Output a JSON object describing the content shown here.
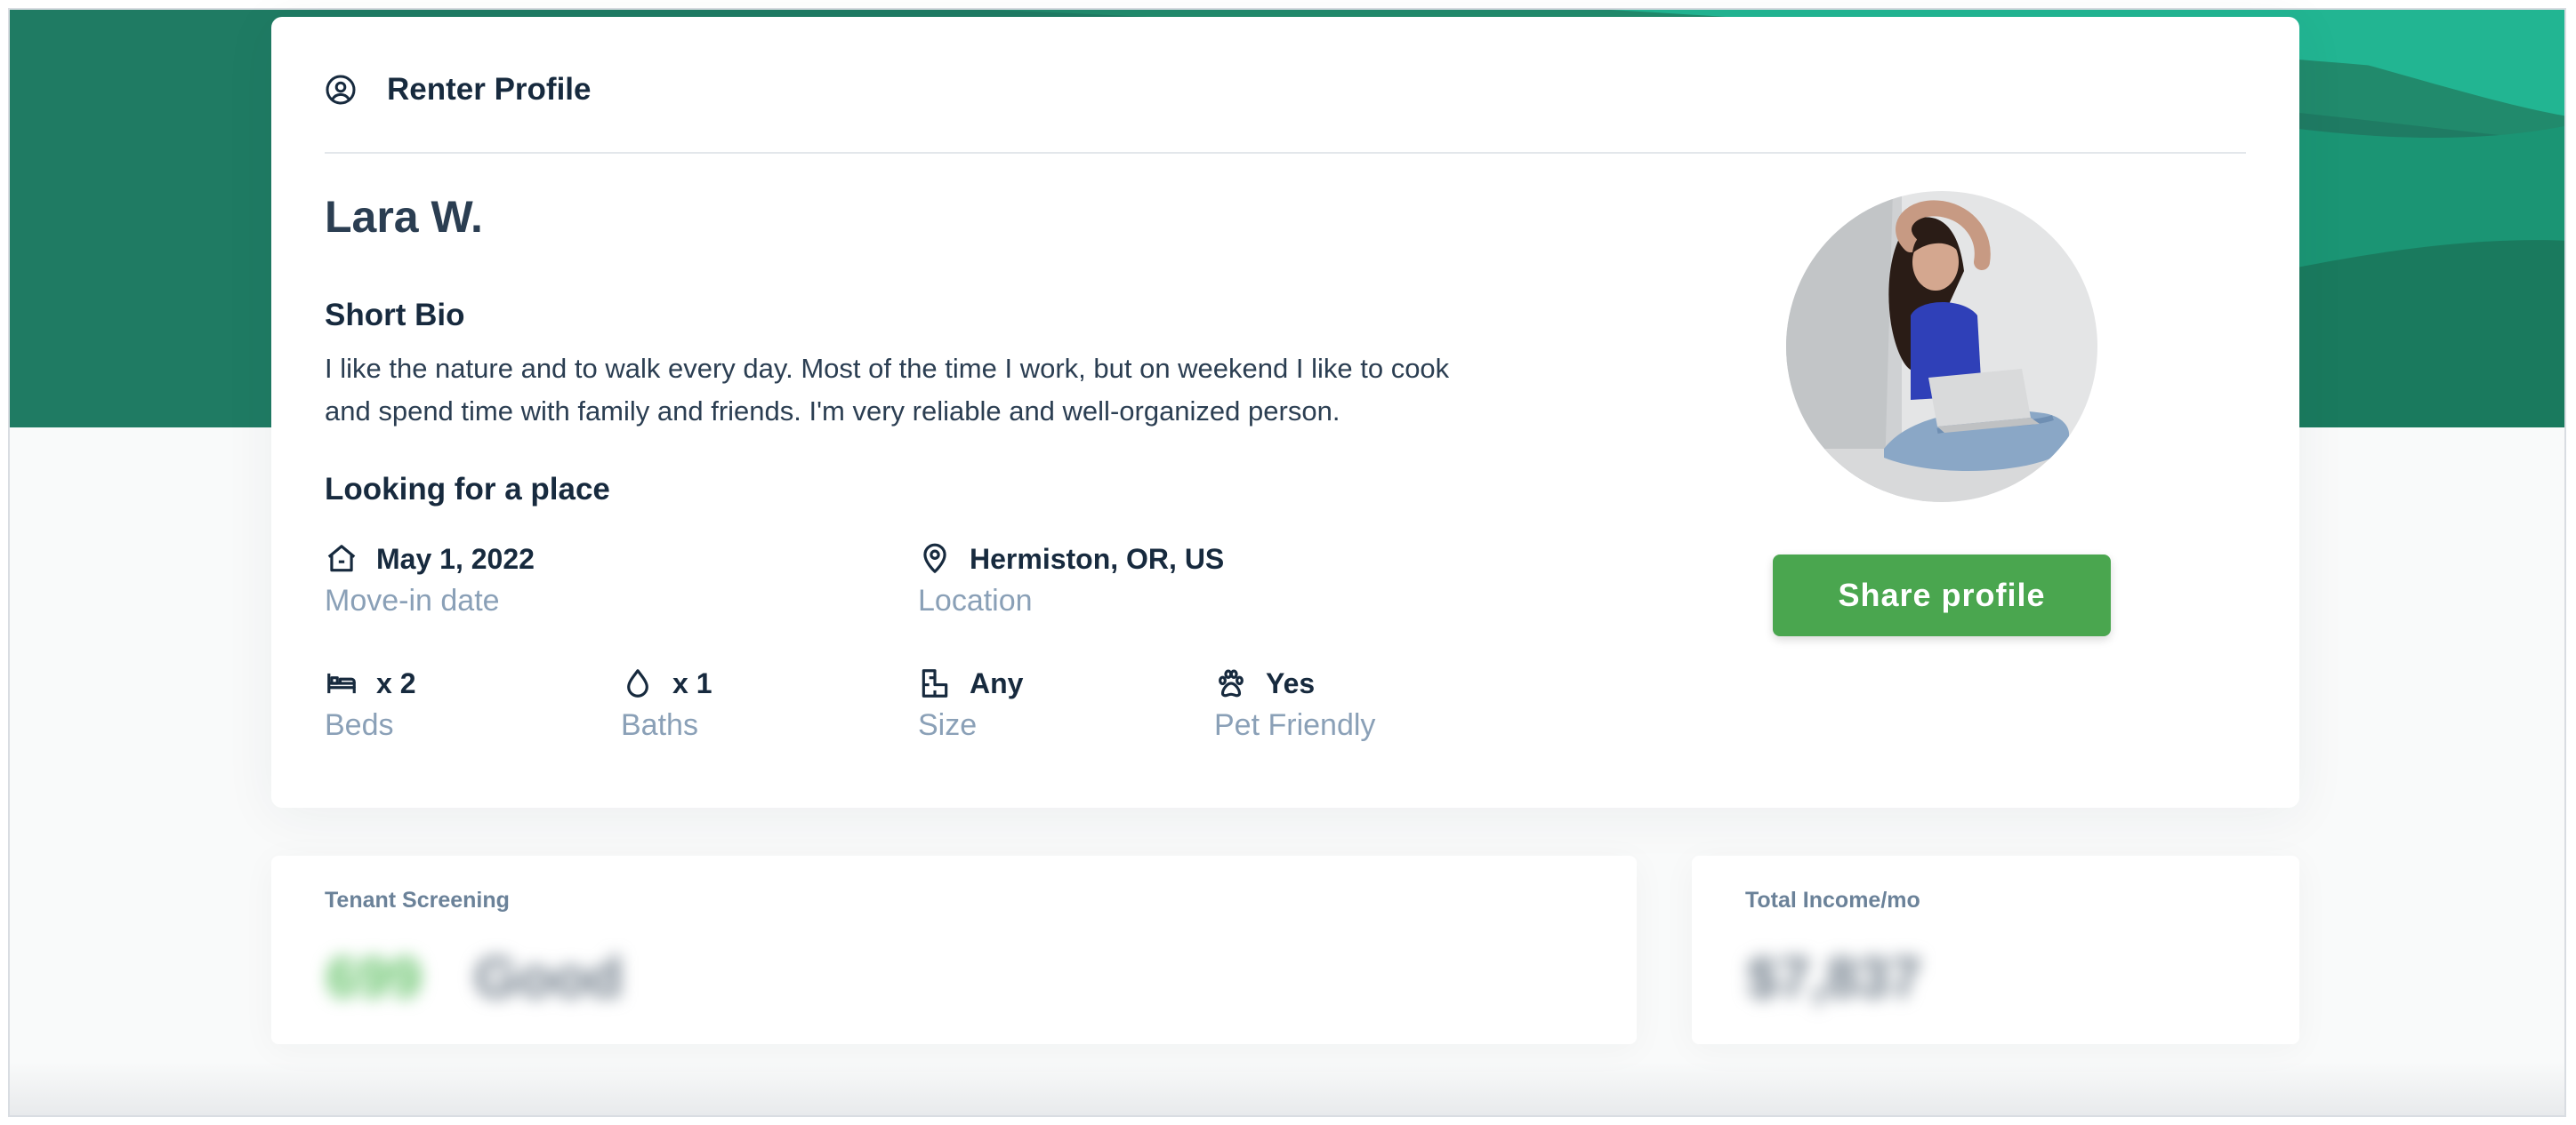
{
  "card": {
    "title": "Renter Profile",
    "header_icon": "user-circle-icon"
  },
  "profile": {
    "name": "Lara W.",
    "bio_heading": "Short Bio",
    "bio_line1": "I like the nature and to walk every day. Most of the time I work, but on weekend I like to cook",
    "bio_line2": "and spend time with family and friends. I'm very reliable and well-organized person."
  },
  "looking": {
    "heading": "Looking for a place",
    "move_in": {
      "value": "May 1, 2022",
      "label": "Move-in date",
      "icon": "house-icon"
    },
    "location": {
      "value": "Hermiston, OR, US",
      "label": "Location",
      "icon": "map-pin-icon"
    },
    "beds": {
      "value": "x 2",
      "label": "Beds",
      "icon": "bed-icon"
    },
    "baths": {
      "value": "x 1",
      "label": "Baths",
      "icon": "drop-icon"
    },
    "size": {
      "value": "Any",
      "label": "Size",
      "icon": "floor-plan-icon"
    },
    "pets": {
      "value": "Yes",
      "label": "Pet Friendly",
      "icon": "paw-icon"
    }
  },
  "actions": {
    "share_label": "Share profile"
  },
  "screening": {
    "title": "Tenant Screening",
    "blurred_score": "699",
    "blurred_rating": "Good"
  },
  "income": {
    "title": "Total Income/mo",
    "blurred_amount": "$7,837"
  },
  "colors": {
    "hero_green": "#1f7b63",
    "hero_accent": "#22b592",
    "button_green": "#4aa64f",
    "label_gray": "#8aa0b7",
    "heading_navy": "#172a3e"
  }
}
